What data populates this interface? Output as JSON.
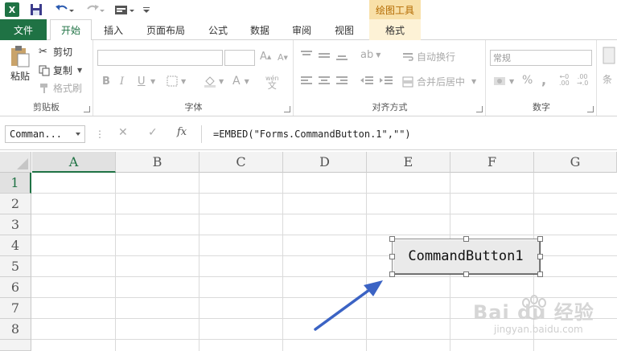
{
  "qat": {
    "excel_icon": "excel-logo-icon",
    "logo_letter": "X",
    "save_icon": "save-icon",
    "undo_icon": "undo-icon",
    "redo_icon": "redo-icon",
    "form_icon": "form-icon",
    "customize_icon": "customize-qat-icon"
  },
  "context_header": "绘图工具",
  "tabs": [
    {
      "label": "文件"
    },
    {
      "label": "开始"
    },
    {
      "label": "插入"
    },
    {
      "label": "页面布局"
    },
    {
      "label": "公式"
    },
    {
      "label": "数据"
    },
    {
      "label": "审阅"
    },
    {
      "label": "视图"
    },
    {
      "label": "格式"
    }
  ],
  "ribbon": {
    "clipboard": {
      "label": "剪贴板",
      "paste": "粘贴",
      "cut": "剪切",
      "copy": "复制",
      "format_painter": "格式刷"
    },
    "font": {
      "label": "字体",
      "font_name": "",
      "font_size": "",
      "bold": "B",
      "italic": "I",
      "underline": "U",
      "phonetic": "wén"
    },
    "alignment": {
      "label": "对齐方式",
      "wrap_text": "自动换行",
      "merge_center": "合并后居中"
    },
    "number": {
      "label": "数字",
      "format": "常规",
      "percent": "%",
      "comma": ","
    },
    "styles": {
      "partial_label": "条"
    }
  },
  "formula_bar": {
    "name_box": "Comman...",
    "fx": "fx",
    "formula": "=EMBED(\"Forms.CommandButton.1\",\"\")"
  },
  "grid": {
    "columns": [
      "A",
      "B",
      "C",
      "D",
      "E",
      "F",
      "G"
    ],
    "rows": [
      "1",
      "2",
      "3",
      "4",
      "5",
      "6",
      "7",
      "8"
    ],
    "selected_column": "A",
    "selected_row": "1"
  },
  "control": {
    "label": "CommandButton1"
  },
  "annotation": {
    "arrow_color": "#3b63c4"
  },
  "watermark": {
    "brand": "Bai du 经验",
    "url": "jingyan.baidu.com"
  },
  "colors": {
    "excel_green": "#1f7244",
    "context_tab": "#f8e0a8"
  }
}
